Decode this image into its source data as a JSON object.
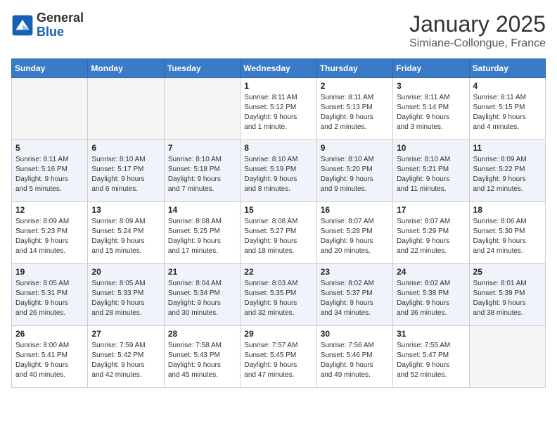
{
  "header": {
    "logo_line1": "General",
    "logo_line2": "Blue",
    "month_title": "January 2025",
    "subtitle": "Simiane-Collongue, France"
  },
  "days_of_week": [
    "Sunday",
    "Monday",
    "Tuesday",
    "Wednesday",
    "Thursday",
    "Friday",
    "Saturday"
  ],
  "weeks": [
    [
      {
        "day": "",
        "info": ""
      },
      {
        "day": "",
        "info": ""
      },
      {
        "day": "",
        "info": ""
      },
      {
        "day": "1",
        "info": "Sunrise: 8:11 AM\nSunset: 5:12 PM\nDaylight: 9 hours\nand 1 minute."
      },
      {
        "day": "2",
        "info": "Sunrise: 8:11 AM\nSunset: 5:13 PM\nDaylight: 9 hours\nand 2 minutes."
      },
      {
        "day": "3",
        "info": "Sunrise: 8:11 AM\nSunset: 5:14 PM\nDaylight: 9 hours\nand 3 minutes."
      },
      {
        "day": "4",
        "info": "Sunrise: 8:11 AM\nSunset: 5:15 PM\nDaylight: 9 hours\nand 4 minutes."
      }
    ],
    [
      {
        "day": "5",
        "info": "Sunrise: 8:11 AM\nSunset: 5:16 PM\nDaylight: 9 hours\nand 5 minutes."
      },
      {
        "day": "6",
        "info": "Sunrise: 8:10 AM\nSunset: 5:17 PM\nDaylight: 9 hours\nand 6 minutes."
      },
      {
        "day": "7",
        "info": "Sunrise: 8:10 AM\nSunset: 5:18 PM\nDaylight: 9 hours\nand 7 minutes."
      },
      {
        "day": "8",
        "info": "Sunrise: 8:10 AM\nSunset: 5:19 PM\nDaylight: 9 hours\nand 8 minutes."
      },
      {
        "day": "9",
        "info": "Sunrise: 8:10 AM\nSunset: 5:20 PM\nDaylight: 9 hours\nand 9 minutes."
      },
      {
        "day": "10",
        "info": "Sunrise: 8:10 AM\nSunset: 5:21 PM\nDaylight: 9 hours\nand 11 minutes."
      },
      {
        "day": "11",
        "info": "Sunrise: 8:09 AM\nSunset: 5:22 PM\nDaylight: 9 hours\nand 12 minutes."
      }
    ],
    [
      {
        "day": "12",
        "info": "Sunrise: 8:09 AM\nSunset: 5:23 PM\nDaylight: 9 hours\nand 14 minutes."
      },
      {
        "day": "13",
        "info": "Sunrise: 8:09 AM\nSunset: 5:24 PM\nDaylight: 9 hours\nand 15 minutes."
      },
      {
        "day": "14",
        "info": "Sunrise: 8:08 AM\nSunset: 5:25 PM\nDaylight: 9 hours\nand 17 minutes."
      },
      {
        "day": "15",
        "info": "Sunrise: 8:08 AM\nSunset: 5:27 PM\nDaylight: 9 hours\nand 18 minutes."
      },
      {
        "day": "16",
        "info": "Sunrise: 8:07 AM\nSunset: 5:28 PM\nDaylight: 9 hours\nand 20 minutes."
      },
      {
        "day": "17",
        "info": "Sunrise: 8:07 AM\nSunset: 5:29 PM\nDaylight: 9 hours\nand 22 minutes."
      },
      {
        "day": "18",
        "info": "Sunrise: 8:06 AM\nSunset: 5:30 PM\nDaylight: 9 hours\nand 24 minutes."
      }
    ],
    [
      {
        "day": "19",
        "info": "Sunrise: 8:05 AM\nSunset: 5:31 PM\nDaylight: 9 hours\nand 26 minutes."
      },
      {
        "day": "20",
        "info": "Sunrise: 8:05 AM\nSunset: 5:33 PM\nDaylight: 9 hours\nand 28 minutes."
      },
      {
        "day": "21",
        "info": "Sunrise: 8:04 AM\nSunset: 5:34 PM\nDaylight: 9 hours\nand 30 minutes."
      },
      {
        "day": "22",
        "info": "Sunrise: 8:03 AM\nSunset: 5:35 PM\nDaylight: 9 hours\nand 32 minutes."
      },
      {
        "day": "23",
        "info": "Sunrise: 8:02 AM\nSunset: 5:37 PM\nDaylight: 9 hours\nand 34 minutes."
      },
      {
        "day": "24",
        "info": "Sunrise: 8:02 AM\nSunset: 5:38 PM\nDaylight: 9 hours\nand 36 minutes."
      },
      {
        "day": "25",
        "info": "Sunrise: 8:01 AM\nSunset: 5:39 PM\nDaylight: 9 hours\nand 38 minutes."
      }
    ],
    [
      {
        "day": "26",
        "info": "Sunrise: 8:00 AM\nSunset: 5:41 PM\nDaylight: 9 hours\nand 40 minutes."
      },
      {
        "day": "27",
        "info": "Sunrise: 7:59 AM\nSunset: 5:42 PM\nDaylight: 9 hours\nand 42 minutes."
      },
      {
        "day": "28",
        "info": "Sunrise: 7:58 AM\nSunset: 5:43 PM\nDaylight: 9 hours\nand 45 minutes."
      },
      {
        "day": "29",
        "info": "Sunrise: 7:57 AM\nSunset: 5:45 PM\nDaylight: 9 hours\nand 47 minutes."
      },
      {
        "day": "30",
        "info": "Sunrise: 7:56 AM\nSunset: 5:46 PM\nDaylight: 9 hours\nand 49 minutes."
      },
      {
        "day": "31",
        "info": "Sunrise: 7:55 AM\nSunset: 5:47 PM\nDaylight: 9 hours\nand 52 minutes."
      },
      {
        "day": "",
        "info": ""
      }
    ]
  ]
}
